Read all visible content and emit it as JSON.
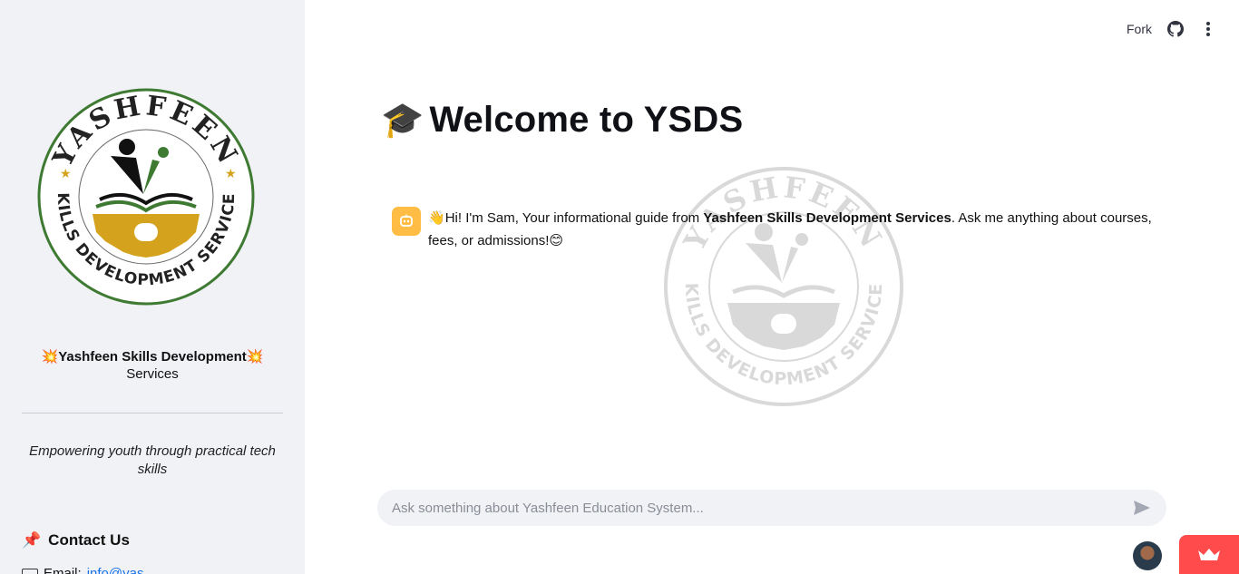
{
  "header": {
    "fork_label": "Fork",
    "github_icon": "github-icon",
    "menu_icon": "kebab-menu-icon"
  },
  "sidebar": {
    "logo": {
      "top_text": "YASHFEEN",
      "bottom_text": "SKILLS DEVELOPMENT SERVICES",
      "colors": {
        "green": "#3f7a33",
        "gold": "#d4a21c",
        "black": "#111111"
      }
    },
    "brand_emoji": "💥",
    "brand_line1": "Yashfeen Skills Development",
    "brand_line2": "Services",
    "tagline": "Empowering youth through practical tech skills",
    "contact_emoji": "📌",
    "contact_title": "Contact Us",
    "email_label": "Email:",
    "email_value": "info@yas..."
  },
  "main": {
    "title_emoji": "🎓",
    "title": "Welcome to YSDS",
    "message": {
      "sender_icon": "bot-face-icon",
      "emoji_start": "👋",
      "text_before": "Hi! I'm Sam, Your informational guide from ",
      "bold": "Yashfeen Skills Development Services",
      "text_after": ". Ask me anything about courses, fees, or admissions!",
      "emoji_end": "😊"
    },
    "chat_input": {
      "placeholder": "Ask something about Yashfeen Education System...",
      "value": ""
    }
  },
  "colors": {
    "sidebar_bg": "#f0f2f6",
    "accent": "#ff4b4b",
    "bot_avatar": "#ffbd45",
    "link": "#1a73e8"
  }
}
